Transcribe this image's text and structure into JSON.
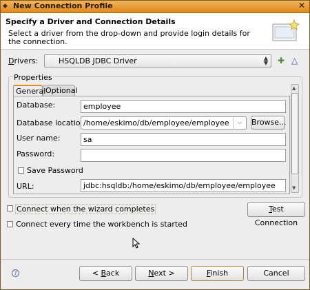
{
  "window": {
    "title": "New Connection Profile",
    "close_glyph": "✕"
  },
  "banner": {
    "title": "Specify a Driver and Connection Details",
    "description": "Select a driver from the drop-down and provide login details for the connection."
  },
  "drivers": {
    "label_mnemonic": "D",
    "label_rest": "rivers:",
    "selected": "HSQLDB JDBC Driver"
  },
  "properties": {
    "legend": "Properties",
    "tabs": [
      {
        "label": "General"
      },
      {
        "label": "Optional"
      }
    ],
    "fields": {
      "database": {
        "label": "Database:",
        "value": "employee"
      },
      "database_location": {
        "label": "Database location:",
        "value": "/home/eskimo/db/employee/employee",
        "browse_label": "Browse..."
      },
      "user_name": {
        "label": "User name:",
        "value": "sa"
      },
      "password": {
        "label": "Password:",
        "value": ""
      },
      "save_password": {
        "label": "Save Password",
        "checked": false
      },
      "url": {
        "label": "URL:",
        "value": "jdbc:hsqldb:/home/eskimo/db/employee/employee"
      }
    }
  },
  "options": {
    "connect_when_complete": {
      "label": "Connect when the wizard completes",
      "checked": false
    },
    "connect_every_time": {
      "label": "Connect every time the workbench is started",
      "checked": false
    },
    "test_connection_mnemonic": "T",
    "test_connection_rest": "est Connection"
  },
  "buttons": {
    "help_glyph": "?",
    "back_prefix": "< ",
    "back_mnemonic": "B",
    "back_rest": "ack",
    "next_mnemonic": "N",
    "next_rest": "ext >",
    "finish_mnemonic": "F",
    "finish_rest": "inish",
    "cancel": "Cancel"
  },
  "colors": {
    "titlebar": "#e08a1c",
    "accent": "#e08a1c"
  }
}
